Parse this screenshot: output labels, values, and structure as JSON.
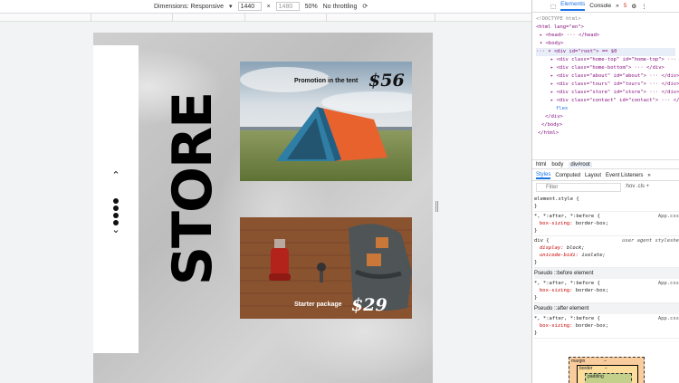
{
  "toolbar": {
    "dimensions_label": "Dimensions: Responsive",
    "width": "1440",
    "times": "×",
    "height": "1480",
    "zoom": "50%",
    "throttle": "No throttling"
  },
  "page": {
    "store_title": "STORE",
    "nav_up": "⌃",
    "nav_down": "⌄",
    "cards": [
      {
        "label": "Promotion in the tent",
        "price": "$56"
      },
      {
        "label": "Starter package",
        "price": "$29"
      }
    ]
  },
  "devtools": {
    "tabs": [
      "Elements",
      "Console"
    ],
    "error_count": "5",
    "dom_lines": [
      "<!DOCTYPE html>",
      "<html lang=\"en\">",
      "▸ <head> ··· </head>",
      "▾ <body>",
      "··· ▾ <div id=\"root\"> == $0",
      "▸ <div class=\"home-top\" id=\"home-top\"> ··· </div>",
      "▸ <div class=\"home-bottom\"> ··· </div>",
      "▸ <div class=\"about\" id=\"about\"> ··· </div>",
      "▸ <div class=\"tours\" id=\"tours\"> ··· </div>",
      "▸ <div class=\"store\" id=\"store\"> ··· </div>",
      "▸ <div class=\"contact\" id=\"contact\"> ··· </div>",
      "flex",
      "</div>",
      "</body>",
      "</html>"
    ],
    "breadcrumbs": [
      "html",
      "body",
      "div#root"
    ],
    "sub_tabs": [
      "Styles",
      "Computed",
      "Layout",
      "Event Listeners",
      "»"
    ],
    "filter_placeholder": "Filter",
    "filter_right": ":hov  .cls  +",
    "styles": {
      "element_style": "element.style {",
      "close": "}",
      "rule1_selector": "*, *:after, *:before {",
      "rule1_src": "App.css",
      "rule1_prop": "box-sizing",
      "rule1_val": "border-box;",
      "div_selector": "div {",
      "div_src": "user agent styleshe",
      "div_prop1": "display",
      "div_val1": "block;",
      "div_prop2": "unicode-bidi",
      "div_val2": "isolate;",
      "pseudo_before": "Pseudo ::before element",
      "pseudo_after": "Pseudo ::after element"
    },
    "boxmodel": {
      "margin": "margin",
      "border": "border",
      "padding": "padding",
      "dash": "–"
    }
  }
}
